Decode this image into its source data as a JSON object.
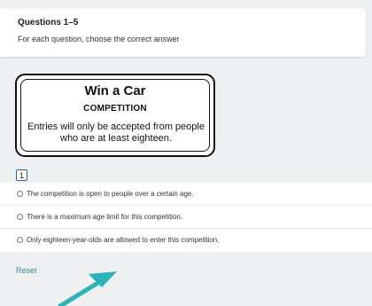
{
  "header": {
    "title": "Questions 1–5",
    "instruction": "For each question, choose the correct answer"
  },
  "notice": {
    "title": "Win a Car",
    "subtitle": "COMPETITION",
    "body": "Entries will only be accepted from people who are at least eighteen."
  },
  "question": {
    "number": "1",
    "options": [
      "The competition is open to people over a certain age.",
      "There is a maximum age limit for this competition.",
      "Only eighteen-year-olds are allowed to enter this competition."
    ]
  },
  "reset_label": "Reset",
  "colors": {
    "accent": "#2e8b96",
    "arrow": "#2ab3b8",
    "question_border": "#2a5ea6",
    "background": "#eef0f1"
  }
}
